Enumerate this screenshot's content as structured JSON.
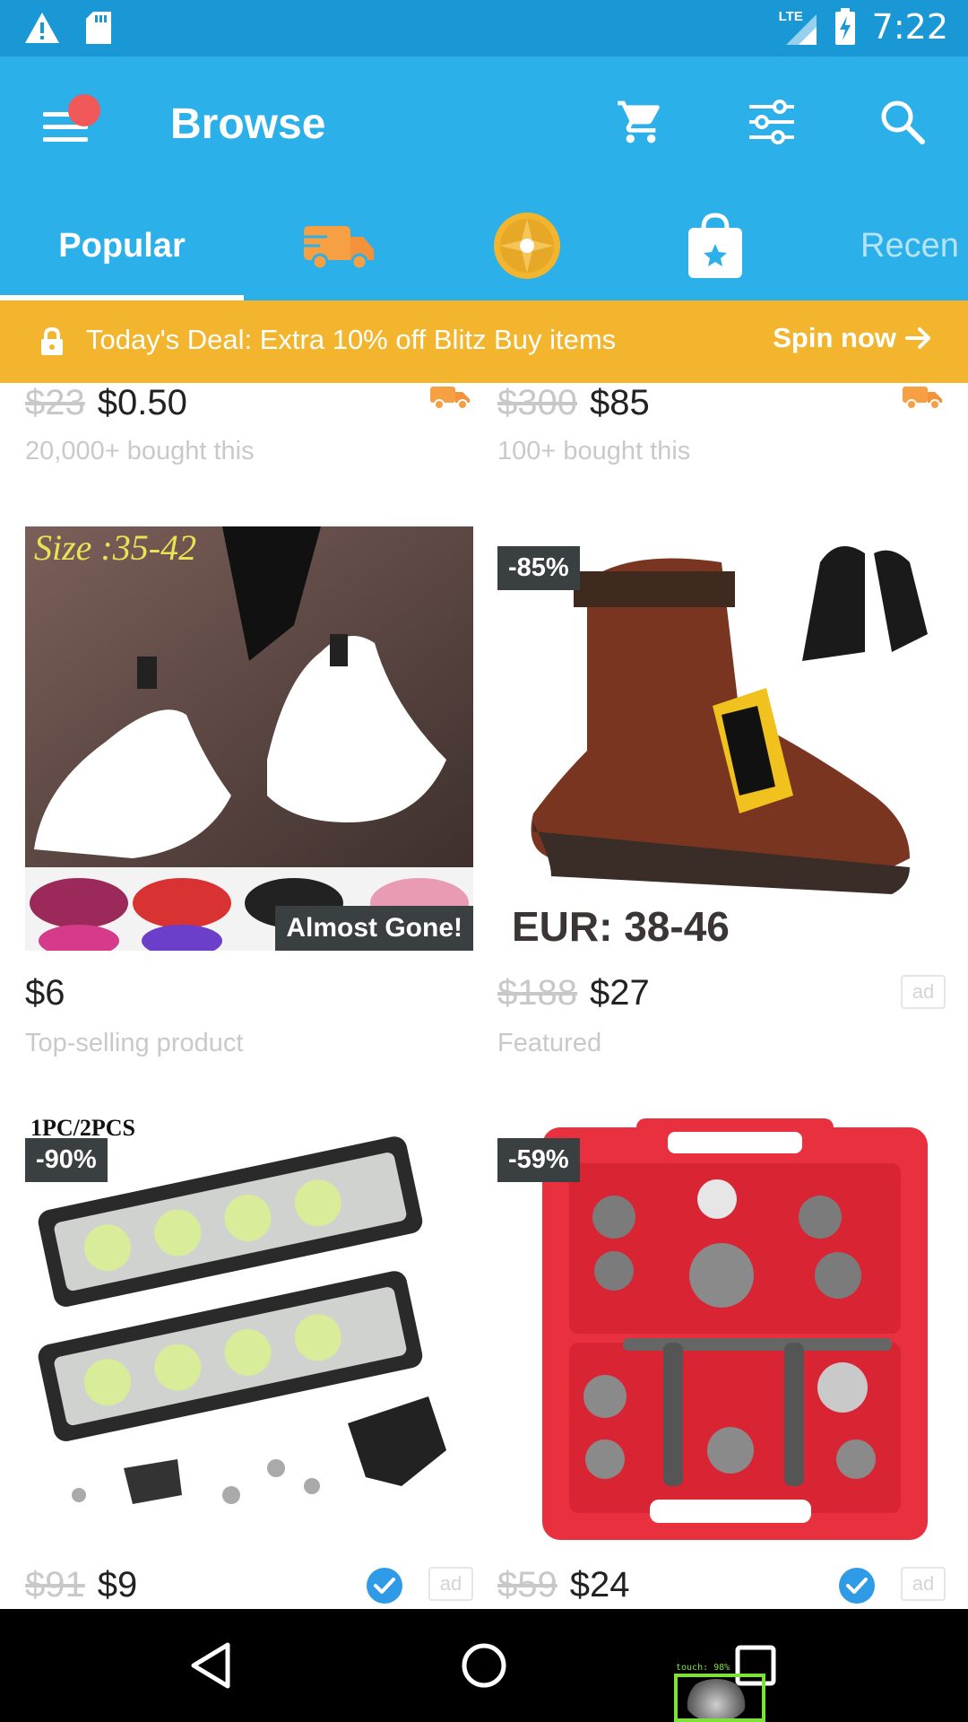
{
  "status_bar": {
    "time": "7:22",
    "network": "LTE",
    "icons": [
      "warning-icon",
      "sd-card-icon",
      "signal-icon",
      "battery-charging-icon"
    ]
  },
  "app_bar": {
    "title": "Browse",
    "actions": [
      "cart-icon",
      "filter-icon",
      "search-icon"
    ],
    "colors": {
      "bar": "#2bb0e9",
      "status": "#1a97d5",
      "badge": "#f0585a"
    }
  },
  "tabs": [
    {
      "label": "Popular",
      "selected": true
    },
    {
      "icon": "delivery-truck-icon"
    },
    {
      "icon": "spin-wheel-icon"
    },
    {
      "icon": "shopping-bag-star-icon"
    },
    {
      "label": "Recen"
    }
  ],
  "deal_banner": {
    "text": "Today's Deal: Extra 10% off Blitz Buy items",
    "cta": "Spin now",
    "color": "#f3b52d"
  },
  "products": [
    {
      "old_price": "$23",
      "price": "$0.50",
      "subtext": "20,000+ bought this",
      "fast_shipping": true
    },
    {
      "old_price": "$300",
      "price": "$85",
      "subtext": "100+ bought this",
      "fast_shipping": true
    },
    {
      "price": "$6",
      "subtext": "Top-selling product",
      "badge": "Almost Gone!",
      "image_text": "Size :35-42"
    },
    {
      "old_price": "$188",
      "price": "$27",
      "subtext": "Featured",
      "discount": "-85%",
      "image_text": "EUR: 38-46",
      "ad": "ad"
    },
    {
      "old_price": "$91",
      "price": "$9",
      "discount": "-90%",
      "image_text": "1PC/2PCS",
      "verified": true,
      "ad": "ad"
    },
    {
      "old_price": "$59",
      "price": "$24",
      "discount": "-59%",
      "verified": true,
      "ad": "ad"
    }
  ],
  "touch_overlay": {
    "label": "touch: 98%"
  },
  "nav": [
    "back-icon",
    "home-icon",
    "recents-icon"
  ]
}
